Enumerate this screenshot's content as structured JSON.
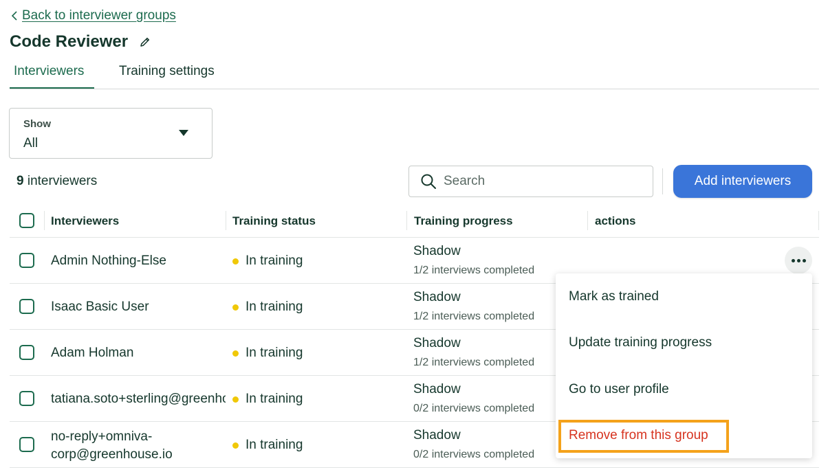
{
  "nav": {
    "back_label": "Back to interviewer groups"
  },
  "page": {
    "title": "Code Reviewer"
  },
  "tabs": [
    {
      "label": "Interviewers",
      "active": true
    },
    {
      "label": "Training settings",
      "active": false
    }
  ],
  "filter": {
    "label": "Show",
    "value": "All"
  },
  "summary": {
    "count": "9",
    "count_suffix": " interviewers"
  },
  "search": {
    "placeholder": "Search"
  },
  "actions": {
    "add_label": "Add interviewers"
  },
  "table": {
    "headers": [
      "Interviewers",
      "Training status",
      "Training progress",
      "actions"
    ],
    "rows": [
      {
        "name": "Admin Nothing-Else",
        "status": "In training",
        "stage": "Shadow",
        "progress": "1/2 interviews completed"
      },
      {
        "name": "Isaac Basic User",
        "status": "In training",
        "stage": "Shadow",
        "progress": "1/2 interviews completed"
      },
      {
        "name": "Adam Holman",
        "status": "In training",
        "stage": "Shadow",
        "progress": "1/2 interviews completed"
      },
      {
        "name": "tatiana.soto+sterling@greenhouse.io",
        "status": "In training",
        "stage": "Shadow",
        "progress": "0/2 interviews completed"
      },
      {
        "name": "no-reply+omniva-corp@greenhouse.io",
        "status": "In training",
        "stage": "Shadow",
        "progress": "0/2 interviews completed"
      }
    ]
  },
  "menu": {
    "items": [
      "Mark as trained",
      "Update training progress",
      "Go to user profile",
      "Remove from this group"
    ]
  },
  "colors": {
    "primary_green": "#1c6b4e",
    "button_blue": "#3a75d9",
    "status_yellow": "#f0c808",
    "danger_red": "#d6331f",
    "highlight_orange": "#f4a21b"
  },
  "icons": [
    "chevron-left-icon",
    "pencil-icon",
    "caret-down-icon",
    "search-icon",
    "more-horizontal-icon"
  ]
}
